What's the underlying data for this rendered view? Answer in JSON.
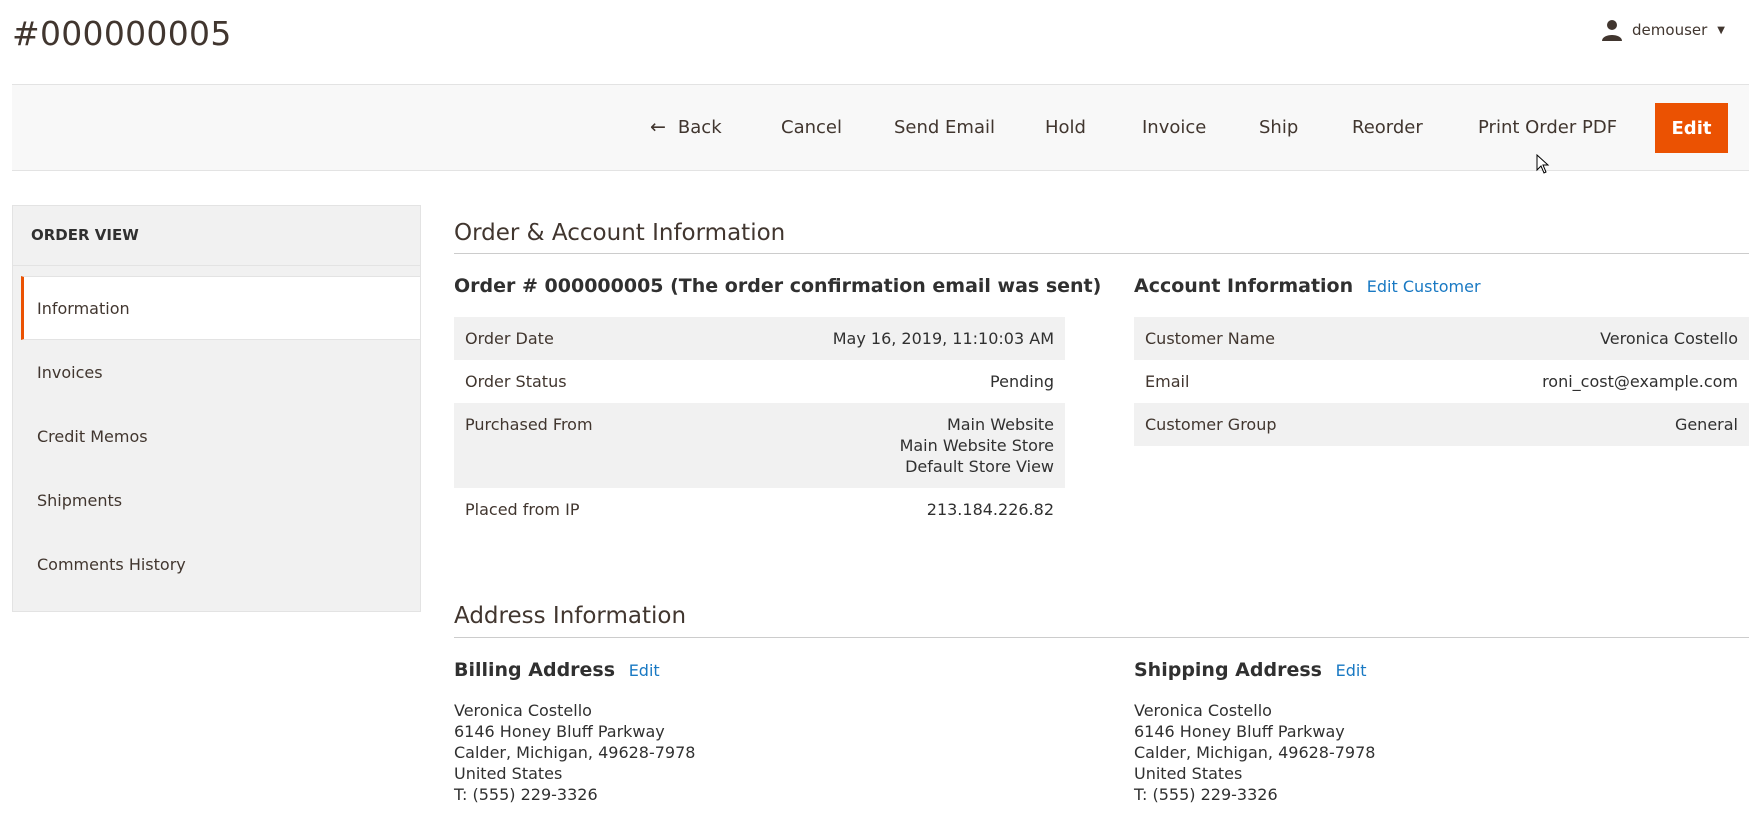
{
  "page": {
    "title": "#000000005"
  },
  "user": {
    "name": "demouser"
  },
  "actions": {
    "back": "Back",
    "cancel": "Cancel",
    "send_email": "Send Email",
    "hold": "Hold",
    "invoice": "Invoice",
    "ship": "Ship",
    "reorder": "Reorder",
    "print_pdf": "Print Order PDF",
    "edit": "Edit"
  },
  "sidebar": {
    "header": "ORDER VIEW",
    "items": [
      "Information",
      "Invoices",
      "Credit Memos",
      "Shipments",
      "Comments History"
    ]
  },
  "order_account": {
    "section_title": "Order & Account Information",
    "order_title": "Order # 000000005 (The order confirmation email was sent)",
    "order_rows": [
      {
        "label": "Order Date",
        "value": "May 16, 2019, 11:10:03 AM"
      },
      {
        "label": "Order Status",
        "value": "Pending"
      },
      {
        "label": "Purchased From",
        "value_lines": [
          "Main Website",
          "Main Website Store",
          "Default Store View"
        ]
      },
      {
        "label": "Placed from IP",
        "value": "213.184.226.82"
      }
    ],
    "account_title": "Account Information",
    "edit_customer": "Edit Customer",
    "account_rows": [
      {
        "label": "Customer Name",
        "value": "Veronica Costello"
      },
      {
        "label": "Email",
        "value": "roni_cost@example.com"
      },
      {
        "label": "Customer Group",
        "value": "General"
      }
    ]
  },
  "address": {
    "section_title": "Address Information",
    "billing_title": "Billing Address",
    "shipping_title": "Shipping Address",
    "edit_label": "Edit",
    "billing_lines": [
      "Veronica Costello",
      "6146 Honey Bluff Parkway",
      "Calder, Michigan, 49628-7978",
      "United States",
      "T: (555) 229-3326"
    ],
    "shipping_lines": [
      "Veronica Costello",
      "6146 Honey Bluff Parkway",
      "Calder, Michigan, 49628-7978",
      "United States",
      "T: (555) 229-3326"
    ]
  },
  "colors": {
    "accent": "#eb5202",
    "link": "#1979c3",
    "shaded": "#f1f1f1"
  },
  "icons": {
    "user": "user-icon",
    "back": "arrow-left-icon",
    "caret": "caret-down-icon"
  }
}
